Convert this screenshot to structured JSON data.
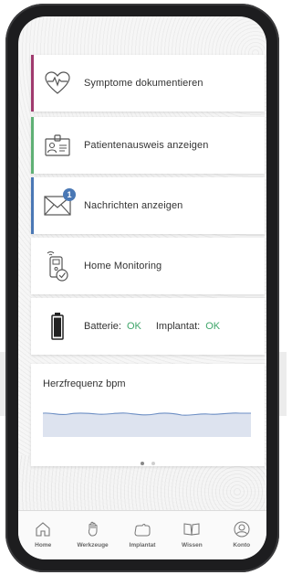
{
  "cards": [
    {
      "label": "Symptome dokumentieren",
      "icon": "heart-pulse-icon",
      "stripe": "#a03a6e"
    },
    {
      "label": "Patientenausweis anzeigen",
      "icon": "id-card-icon",
      "stripe": "#5fb075"
    },
    {
      "label": "Nachrichten anzeigen",
      "icon": "envelope-icon",
      "stripe": "#4a78b5",
      "badge": "1"
    },
    {
      "label": "Home Monitoring",
      "icon": "home-monitoring-device-icon",
      "stripe": ""
    }
  ],
  "status": {
    "battery_label": "Batterie:",
    "battery_value": "OK",
    "implant_label": "Implantat:",
    "implant_value": "OK"
  },
  "heart_rate": {
    "title": "Herzfrequenz bpm",
    "page_index": 0,
    "page_count": 2
  },
  "tabs": [
    {
      "label": "Home",
      "icon": "home-icon"
    },
    {
      "label": "Werkzeuge",
      "icon": "tools-hand-icon"
    },
    {
      "label": "Implantat",
      "icon": "implant-icon"
    },
    {
      "label": "Wissen",
      "icon": "book-icon"
    },
    {
      "label": "Konto",
      "icon": "account-icon"
    }
  ],
  "colors": {
    "ok": "#3fa66a",
    "accent_blue": "#4a78b5"
  }
}
